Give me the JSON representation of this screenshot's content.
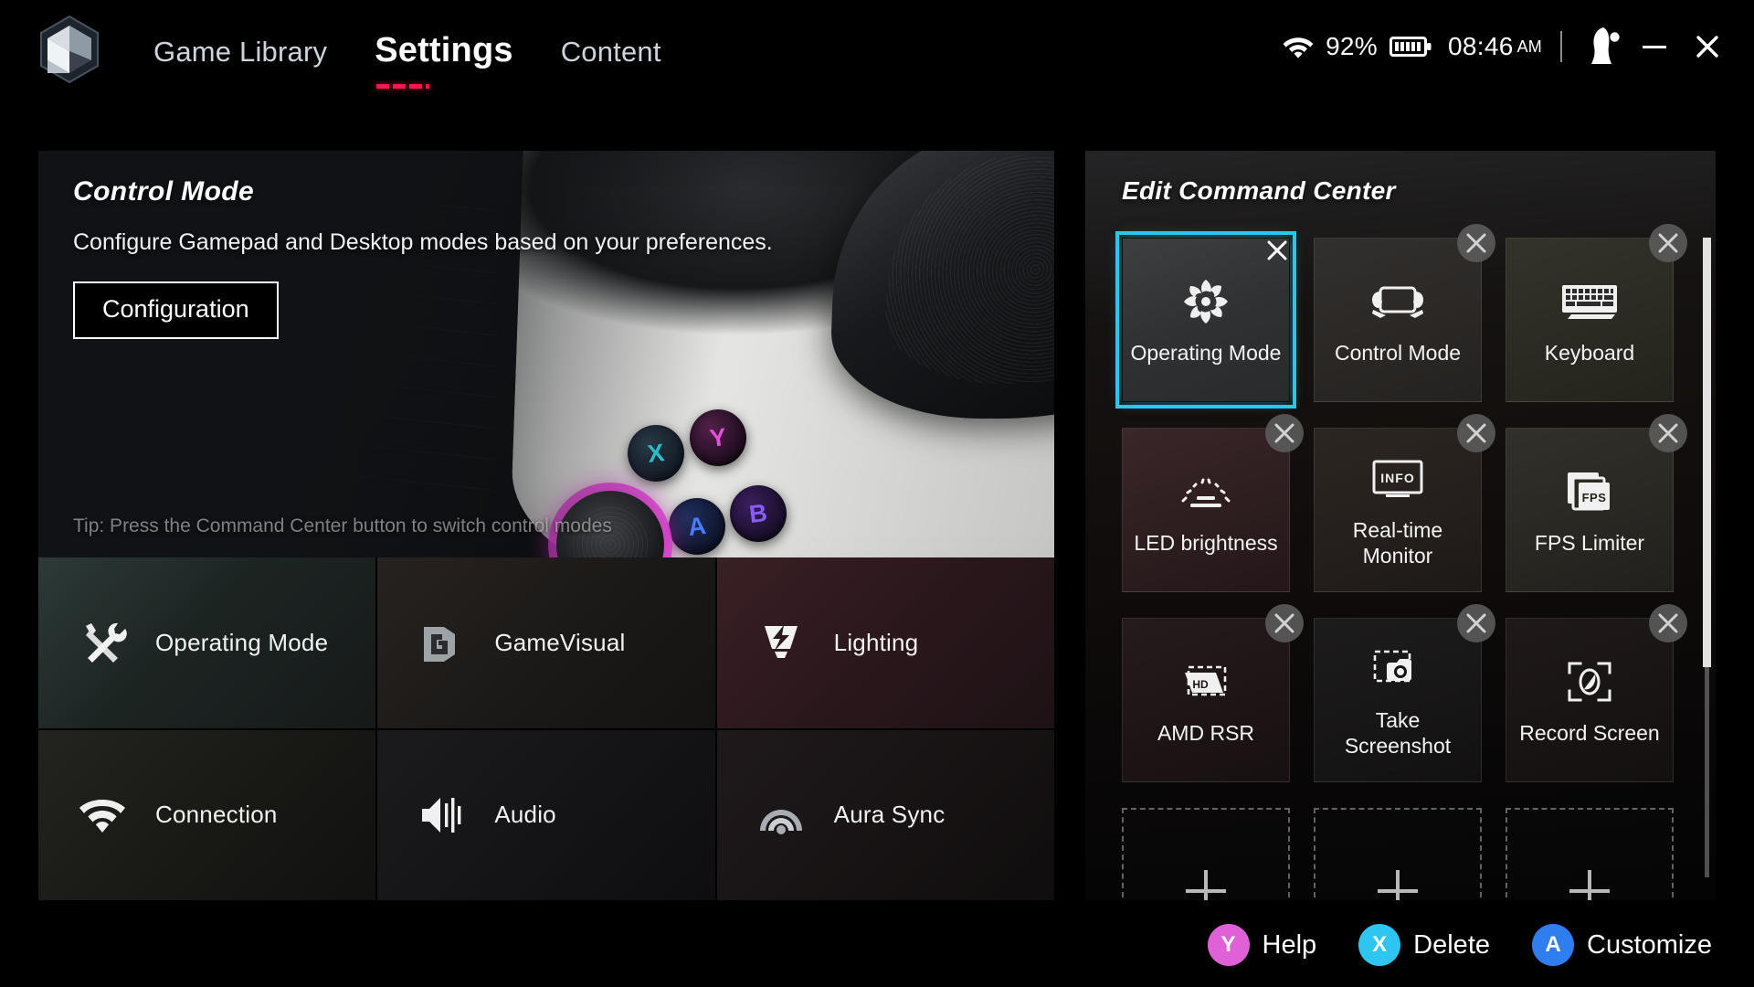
{
  "app": {
    "logo_icon": "armoury-crate-logo"
  },
  "nav": {
    "items": [
      {
        "label": "Game Library",
        "active": false
      },
      {
        "label": "Settings",
        "active": true
      },
      {
        "label": "Content",
        "active": false
      }
    ]
  },
  "status": {
    "wifi_icon": "wifi-icon",
    "battery_percent": "92%",
    "battery_icon": "battery-full-icon",
    "time": "08:46",
    "meridiem": "AM",
    "avatar_icon": "user-avatar-icon",
    "minimize_label": "minimize-icon",
    "close_label": "close-icon"
  },
  "hero": {
    "title": "Control Mode",
    "subtitle": "Configure Gamepad and Desktop modes based on your preferences.",
    "button_label": "Configuration",
    "tip": "Tip: Press the Command Center button to switch control modes",
    "device_buttons": {
      "x": "X",
      "y": "Y",
      "a": "A",
      "b": "B"
    }
  },
  "settings_tiles": [
    {
      "label": "Operating Mode",
      "icon": "tools-icon"
    },
    {
      "label": "GameVisual",
      "icon": "gamevisual-icon"
    },
    {
      "label": "Lighting",
      "icon": "lighting-bolt-icon"
    },
    {
      "label": "Connection",
      "icon": "wifi-icon"
    },
    {
      "label": "Audio",
      "icon": "speaker-icon"
    },
    {
      "label": "Aura Sync",
      "icon": "aura-sync-icon"
    }
  ],
  "command_center": {
    "title": "Edit Command Center",
    "selected_index": 0,
    "selection_color": "#27c6f5",
    "close_glyph": "✕",
    "tiles": [
      {
        "label": "Operating Mode",
        "icon": "fan-turbine-icon",
        "removable": true
      },
      {
        "label": "Control Mode",
        "icon": "gamepad-icon",
        "removable": true
      },
      {
        "label": "Keyboard",
        "icon": "keyboard-icon",
        "removable": true
      },
      {
        "label": "LED brightness",
        "icon": "brightness-icon",
        "removable": true
      },
      {
        "label": "Real-time Monitor",
        "icon": "info-monitor-icon",
        "removable": true
      },
      {
        "label": "FPS Limiter",
        "icon": "fps-stack-icon",
        "removable": true
      },
      {
        "label": "AMD RSR",
        "icon": "hd-upscale-icon",
        "removable": true
      },
      {
        "label": "Take Screenshot",
        "icon": "camera-icon",
        "removable": true
      },
      {
        "label": "Record Screen",
        "icon": "record-screen-icon",
        "removable": true
      }
    ],
    "add_slots": [
      {
        "label": "add-slot-1",
        "icon": "plus-icon"
      },
      {
        "label": "add-slot-2",
        "icon": "plus-icon"
      },
      {
        "label": "add-slot-3",
        "icon": "plus-icon"
      }
    ]
  },
  "bottom_bar": {
    "hints": [
      {
        "button": "Y",
        "label": "Help",
        "color": "#e060d8"
      },
      {
        "button": "X",
        "label": "Delete",
        "color": "#2ec6f0"
      },
      {
        "button": "A",
        "label": "Customize",
        "color": "#2e7ef0"
      }
    ]
  }
}
